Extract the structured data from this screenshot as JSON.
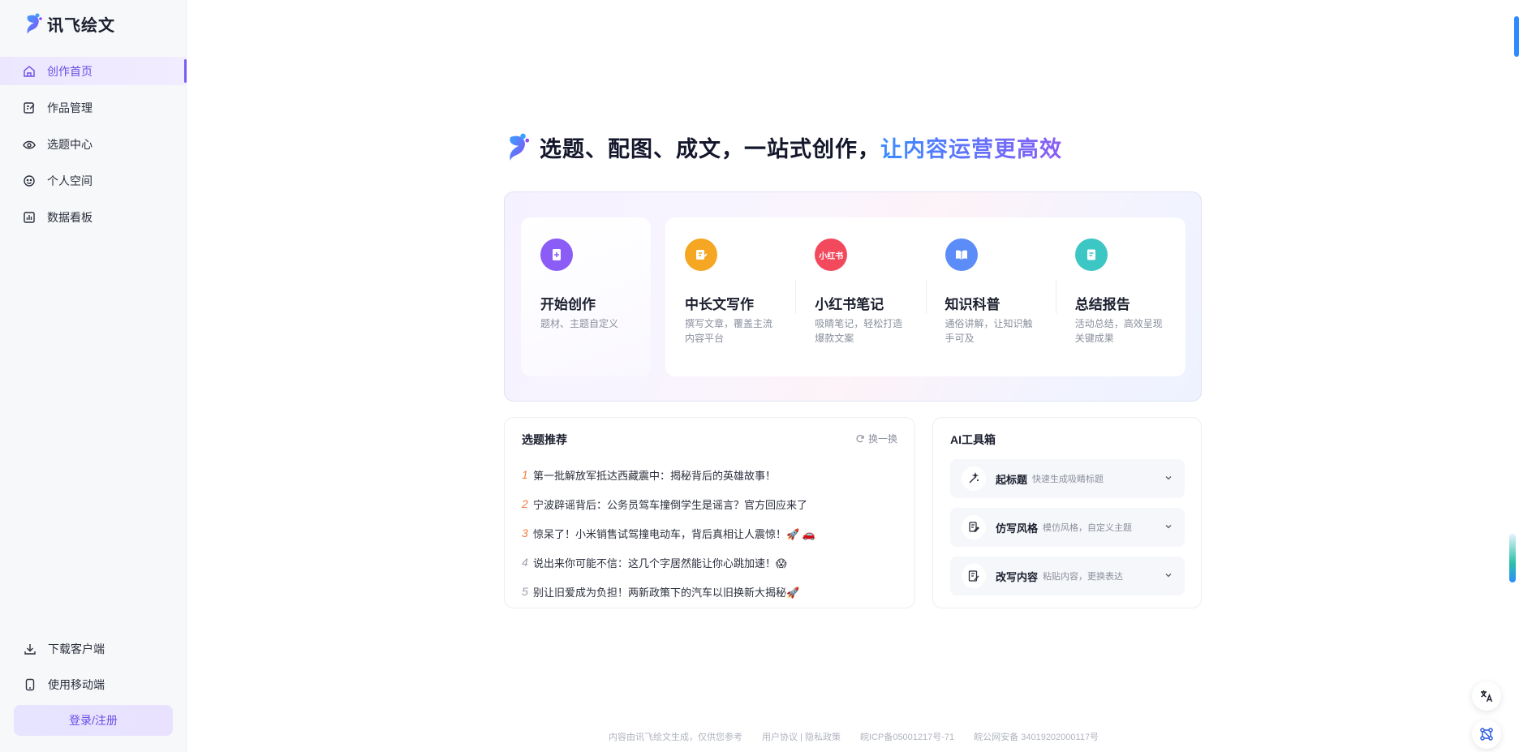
{
  "brand": {
    "name": "讯飞绘文",
    "logo_icon": "feather-logo-icon"
  },
  "sidebar": {
    "items": [
      {
        "label": "创作首页",
        "icon": "home-icon",
        "active": true
      },
      {
        "label": "作品管理",
        "icon": "edit-note-icon",
        "active": false
      },
      {
        "label": "选题中心",
        "icon": "eye-icon",
        "active": false
      },
      {
        "label": "个人空间",
        "icon": "smiley-icon",
        "active": false
      },
      {
        "label": "数据看板",
        "icon": "bar-chart-icon",
        "active": false
      }
    ],
    "bottom": {
      "download": "下载客户端",
      "mobile": "使用移动端",
      "login": "登录/注册"
    }
  },
  "hero": {
    "title_main": "选题、配图、成文，一站式创作，",
    "title_accent": "让内容运营更高效"
  },
  "features": {
    "start": {
      "title": "开始创作",
      "desc": "题材、主题自定义",
      "color": "#8b5cf6"
    },
    "types": [
      {
        "title": "中长文写作",
        "desc": "撰写文章，覆盖主流内容平台",
        "color": "#f5a623",
        "icon": "pen-doc-icon"
      },
      {
        "title": "小红书笔记",
        "desc": "吸睛笔记，轻松打造爆款文案",
        "color": "#f2495c",
        "icon": "xiaohongshu-icon",
        "badge": "小红书"
      },
      {
        "title": "知识科普",
        "desc": "通俗讲解，让知识触手可及",
        "color": "#5b8cf7",
        "icon": "book-icon"
      },
      {
        "title": "总结报告",
        "desc": "活动总结，高效呈现关键成果",
        "color": "#3cc6c4",
        "icon": "report-icon"
      }
    ]
  },
  "topics": {
    "title": "选题推荐",
    "refresh": "换一换",
    "items": [
      {
        "num": "1",
        "text": "第一批解放军抵达西藏震中：揭秘背后的英雄故事！"
      },
      {
        "num": "2",
        "text": "宁波辟谣背后：公务员驾车撞倒学生是谣言？官方回应来了"
      },
      {
        "num": "3",
        "text": "惊呆了！小米销售试驾撞电动车，背后真相让人震惊！🚀 🚗"
      },
      {
        "num": "4",
        "text": "说出来你可能不信：这几个字居然能让你心跳加速！😱"
      },
      {
        "num": "5",
        "text": "别让旧爱成为负担！两新政策下的汽车以旧换新大揭秘🚀"
      }
    ]
  },
  "toolbox": {
    "title": "AI工具箱",
    "tools": [
      {
        "name": "起标题",
        "desc": "快速生成吸睛标题",
        "icon": "magic-wand-icon"
      },
      {
        "name": "仿写风格",
        "desc": "模仿风格，自定义主题",
        "icon": "copy-style-icon"
      },
      {
        "name": "改写内容",
        "desc": "粘贴内容，更换表达",
        "icon": "rewrite-icon"
      }
    ]
  },
  "footer": {
    "disclaimer": "内容由讯飞绘文生成，仅供您参考",
    "links": "用户协议 | 隐私政策",
    "icp": "皖ICP备05001217号-71",
    "police": "皖公网安备 34019202000117号"
  },
  "colors": {
    "accent": "#7b5cf0",
    "topic_number": "#f07b3f"
  }
}
